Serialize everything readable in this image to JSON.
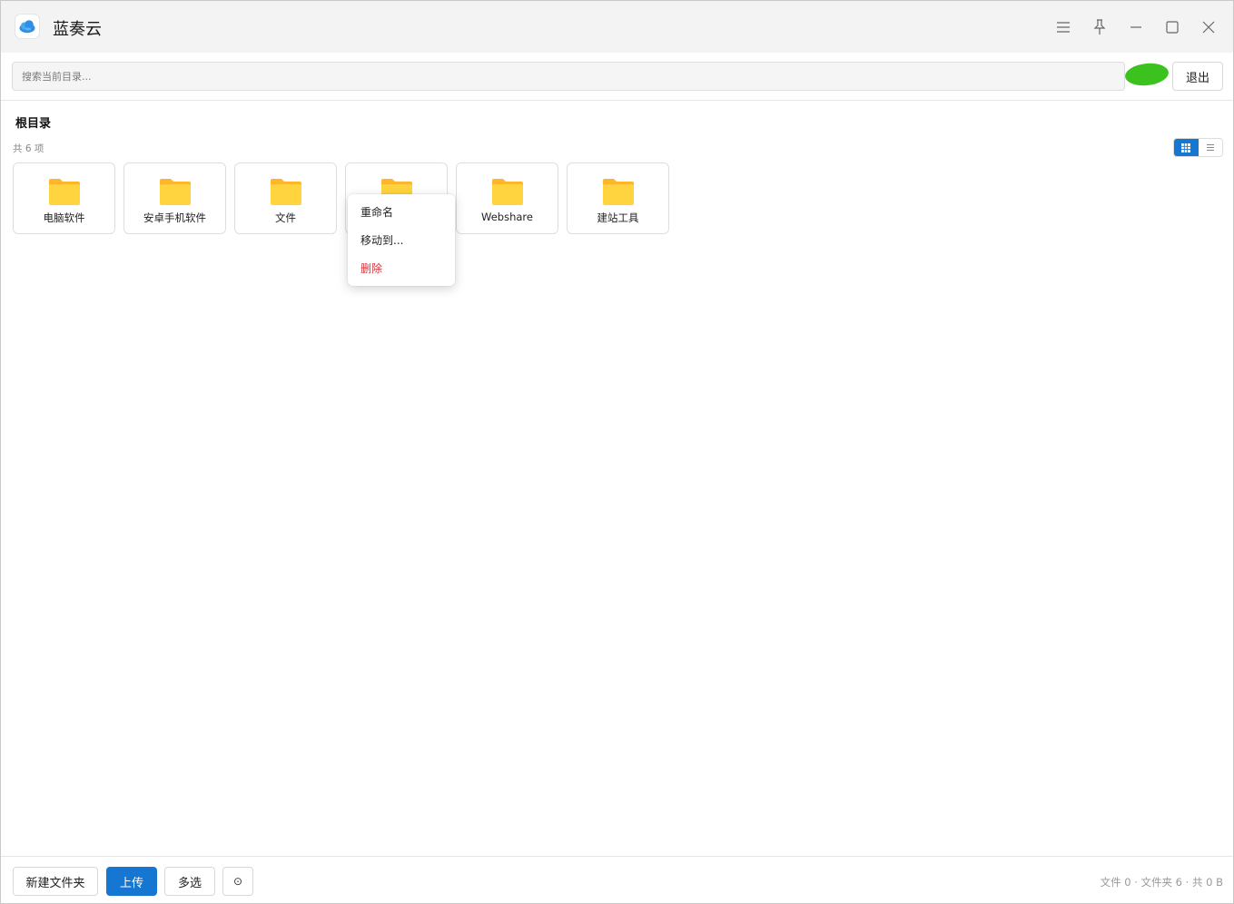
{
  "app": {
    "title": "蓝奏云"
  },
  "window_controls": [
    "menu-icon",
    "pin-icon",
    "minimize-icon",
    "maximize-icon",
    "close-icon"
  ],
  "search": {
    "placeholder": "搜索当前目录...",
    "value": ""
  },
  "header": {
    "logout_label": "退出"
  },
  "breadcrumb": "根目录",
  "summary": "共 6 项",
  "view_toggle": {
    "selected": "grid",
    "options": [
      "grid",
      "list"
    ]
  },
  "folders": [
    {
      "name": "电脑软件"
    },
    {
      "name": "安卓手机软件"
    },
    {
      "name": "文件"
    },
    {
      "name": ""
    },
    {
      "name": "Webshare"
    },
    {
      "name": "建站工具"
    }
  ],
  "context_menu": {
    "items": [
      {
        "label": "重命名"
      },
      {
        "label": "移动到..."
      },
      {
        "label": "删除",
        "color": "#d0333a"
      }
    ]
  },
  "bottom": {
    "new_folder_label": "新建文件夹",
    "upload_label": "上传",
    "multiselect_label": "多选",
    "settings_glyph": "⊙",
    "status": "文件 0 · 文件夹 6 · 共 0 B"
  },
  "colors": {
    "accent": "#1677d2",
    "folder": "#ffd43f",
    "folder_tab": "#ffb62b",
    "danger": "#d0333a"
  }
}
